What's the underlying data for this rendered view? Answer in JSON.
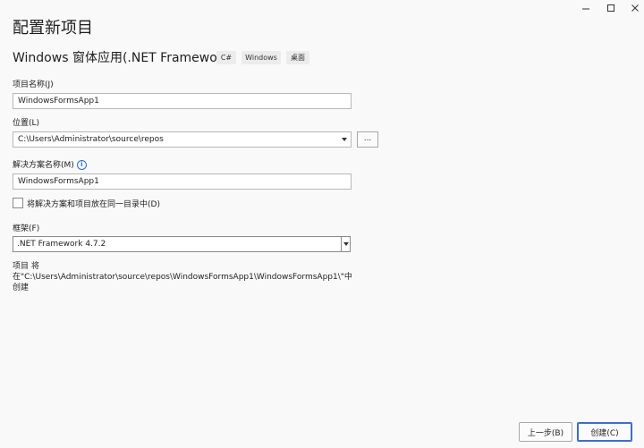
{
  "window": {
    "title": "配置新项目"
  },
  "template": {
    "name": "Windows 窗体应用(.NET Framework)",
    "tags": [
      "C#",
      "Windows",
      "桌面"
    ]
  },
  "project_name": {
    "label": "项目名称(J)",
    "value": "WindowsFormsApp1"
  },
  "location": {
    "label": "位置(L)",
    "value": "C:\\Users\\Administrator\\source\\repos",
    "browse_label": "..."
  },
  "solution_name": {
    "label": "解决方案名称(M)",
    "value": "WindowsFormsApp1",
    "info_icon": "info-icon"
  },
  "same_dir": {
    "label": "将解决方案和项目放在同一目录中(D)",
    "checked": false
  },
  "framework": {
    "label": "框架(F)",
    "value": ".NET Framework 4.7.2"
  },
  "note": "项目 将在\"C:\\Users\\Administrator\\source\\repos\\WindowsFormsApp1\\WindowsFormsApp1\\\"中创建",
  "footer": {
    "back_label": "上一步(B)",
    "create_label": "创建(C)"
  }
}
